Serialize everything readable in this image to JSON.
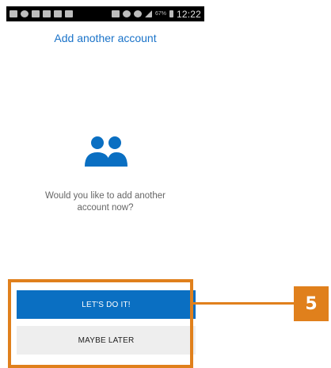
{
  "status_bar": {
    "battery_percent": "67%",
    "time": "12:22"
  },
  "screen": {
    "title": "Add another account",
    "icon": "people-icon",
    "prompt": "Would you like to add another account now?"
  },
  "buttons": {
    "primary_label": "LET'S DO IT!",
    "secondary_label": "MAYBE LATER"
  },
  "annotation": {
    "step_number": "5"
  },
  "colors": {
    "accent": "#0a6fc2",
    "link": "#1a73c9",
    "highlight": "#e0801c"
  }
}
